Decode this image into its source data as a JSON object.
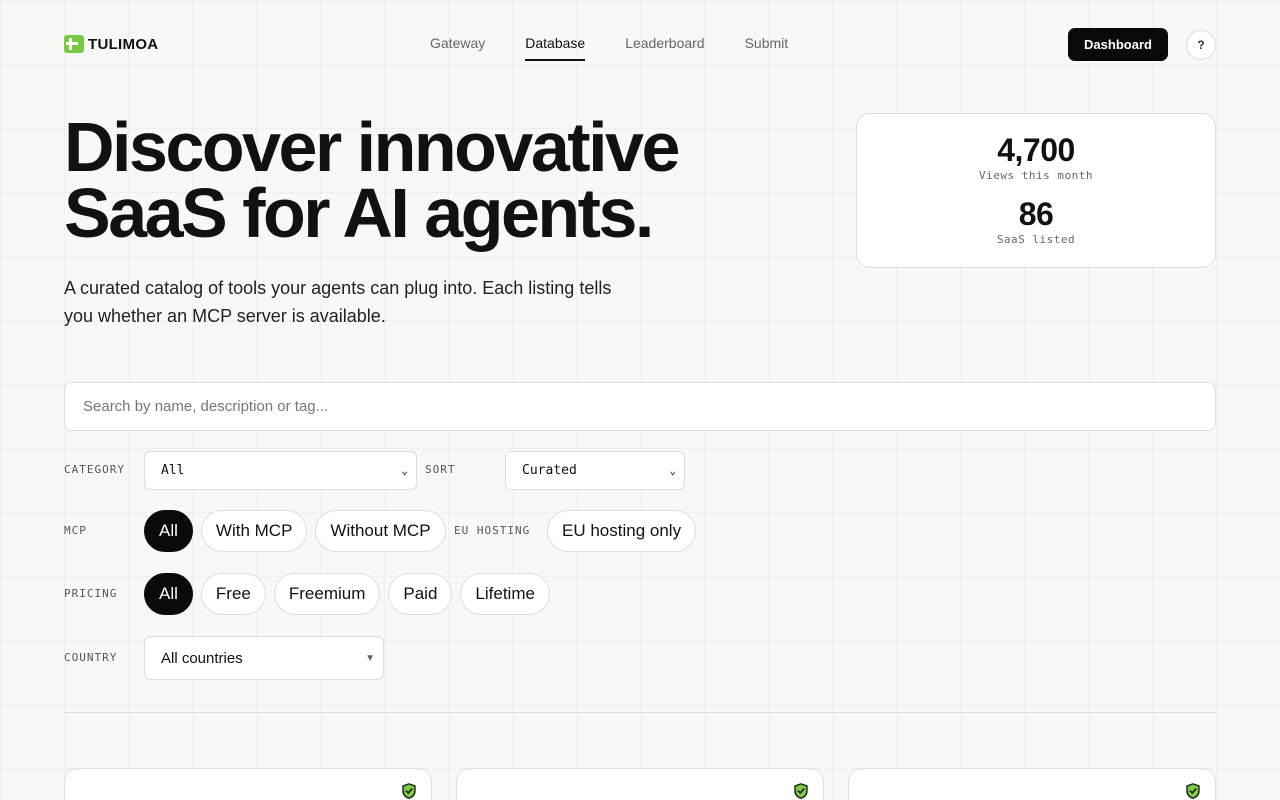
{
  "brand": {
    "name": "TULIMOA"
  },
  "nav": {
    "items": [
      "Gateway",
      "Database",
      "Leaderboard",
      "Submit"
    ],
    "active": "Database"
  },
  "header": {
    "dashboard_label": "Dashboard",
    "help_label": "?"
  },
  "hero": {
    "title_line1": "Discover innovative",
    "title_line2": "SaaS for AI agents.",
    "subtitle": "A curated catalog of tools your agents can plug into. Each listing tells you whether an MCP server is available."
  },
  "stats": [
    {
      "value": "4,700",
      "label": "Views this month"
    },
    {
      "value": "86",
      "label": "SaaS listed"
    }
  ],
  "search": {
    "placeholder": "Search by name, description or tag..."
  },
  "filters": {
    "category": {
      "label": "CATEGORY",
      "value": "All"
    },
    "sort": {
      "label": "SORT",
      "value": "Curated"
    },
    "mcp": {
      "label": "MCP",
      "options": [
        "All",
        "With MCP",
        "Without MCP"
      ],
      "selected": "All"
    },
    "eu_hosting": {
      "label": "EU HOSTING",
      "option": "EU hosting only"
    },
    "pricing": {
      "label": "PRICING",
      "options": [
        "All",
        "Free",
        "Freemium",
        "Paid",
        "Lifetime"
      ],
      "selected": "All"
    },
    "country": {
      "label": "COUNTRY",
      "value": "All countries"
    }
  },
  "colors": {
    "accent": "#7ac943",
    "shield_fill": "#7ac943",
    "dark": "#0a0a0a"
  },
  "cards": [
    {
      "badge_icon": "shield-check-icon"
    },
    {
      "badge_icon": "shield-check-icon"
    },
    {
      "badge_icon": "shield-check-icon"
    }
  ]
}
